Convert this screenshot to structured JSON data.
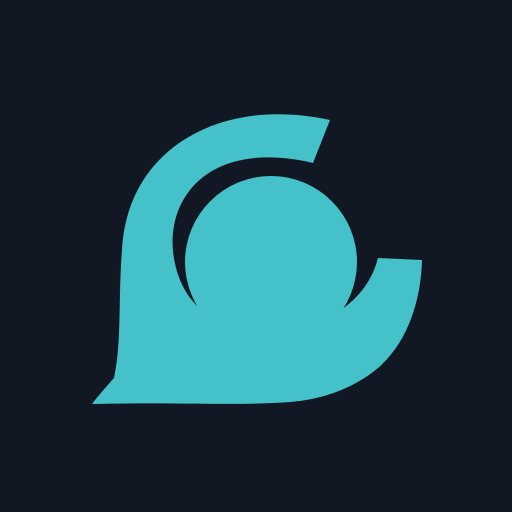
{
  "icon": {
    "name": "speech-bubble-circle-logo",
    "background_color": "#111723",
    "accent_color": "#45C2C9"
  }
}
